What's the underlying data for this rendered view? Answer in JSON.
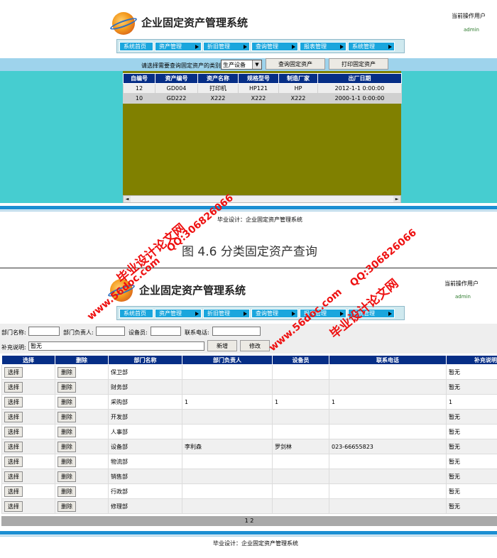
{
  "app": {
    "title": "企业固定资产管理系统",
    "current_user_label": "当前操作用户",
    "current_user": "admin",
    "nav": [
      "系统首页",
      "资产管理",
      "折旧管理",
      "查询管理",
      "报表管理",
      "系统管理"
    ],
    "footer": "毕业设计：企业固定资产管理系统"
  },
  "screen1": {
    "filter_label": "请选择需要查询固定资产的类别：",
    "category_selected": "生产设备",
    "query_button": "查询固定资产",
    "print_button": "打印固定资产",
    "table": {
      "headers": [
        "自编号",
        "资产编号",
        "资产名称",
        "规格型号",
        "制造厂家",
        "出厂日期"
      ],
      "rows": [
        [
          "12",
          "GD004",
          "打印机",
          "HP121",
          "HP",
          "2012-1-1 0:00:00"
        ],
        [
          "10",
          "GD222",
          "X222",
          "X222",
          "X222",
          "2000-1-1 0:00:00"
        ]
      ]
    }
  },
  "caption": "图 4.6  分类固定资产查询",
  "watermarks": [
    "毕业设计论文网",
    "QQ:306826066",
    "www.56doc.com"
  ],
  "screen2": {
    "form": {
      "dept_name_label": "部门名称:",
      "dept_head_label": "部门负责人:",
      "equip_label": "设备员:",
      "phone_label": "联系电话:",
      "remark_label": "补充说明:",
      "remark_value": "暂无",
      "add_button": "新增",
      "modify_button": "修改"
    },
    "table": {
      "headers": [
        "选择",
        "删除",
        "部门名称",
        "部门负责人",
        "设备员",
        "联系电话",
        "补充说明"
      ],
      "select_label": "选择",
      "delete_label": "删除",
      "rows": [
        [
          "保卫部",
          "",
          "",
          "",
          "暂无"
        ],
        [
          "财务部",
          "",
          "",
          "",
          "暂无"
        ],
        [
          "采购部",
          "1",
          "1",
          "1",
          "1"
        ],
        [
          "开发部",
          "",
          "",
          "",
          "暂无"
        ],
        [
          "人事部",
          "",
          "",
          "",
          "暂无"
        ],
        [
          "设备部",
          "李利森",
          "罗剑林",
          "023-66655823",
          "暂无"
        ],
        [
          "物流部",
          "",
          "",
          "",
          "暂无"
        ],
        [
          "销售部",
          "",
          "",
          "",
          "暂无"
        ],
        [
          "行政部",
          "",
          "",
          "",
          "暂无"
        ],
        [
          "修理部",
          "",
          "",
          "",
          "暂无"
        ]
      ],
      "pager": "1 2"
    }
  },
  "colors": {
    "nav_button": "#1aa6dd",
    "table_header": "#062e86",
    "teal_panel": "#46cdd0",
    "olive_panel": "#808000",
    "footer_bar": "#1b8fd2",
    "watermark": "#e11111"
  }
}
